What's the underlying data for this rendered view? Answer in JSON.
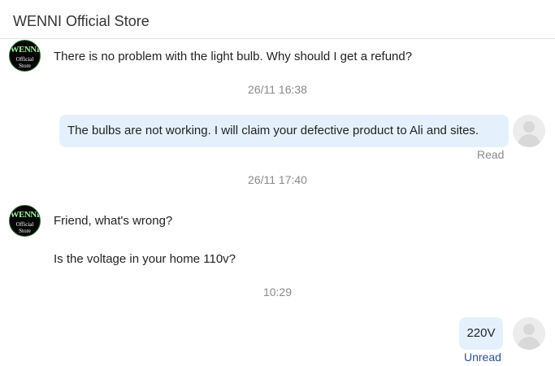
{
  "header": {
    "title": "WENNI Official Store"
  },
  "store_avatar": {
    "line1": "WENNI",
    "line2": "Official",
    "line3": "Store"
  },
  "messages": [
    {
      "from": "store",
      "text": "There is no problem with the light bulb. Why should I get a refund?"
    },
    {
      "timestamp": "26/11 16:38"
    },
    {
      "from": "user",
      "text": "The bulbs are not working. I will claim your defective product to Ali and sites.",
      "status": "Read"
    },
    {
      "timestamp": "26/11 17:40"
    },
    {
      "from": "store",
      "text": "Friend, what's wrong?"
    },
    {
      "from": "store",
      "text": "Is the voltage in your home 110v?"
    },
    {
      "timestamp": "10:29"
    },
    {
      "from": "user",
      "text": "220V",
      "status": "Unread"
    }
  ],
  "colors": {
    "user_bubble": "#e4f1fd",
    "timestamp_text": "#8a8a8a",
    "unread_status": "#2e4f8a",
    "store_avatar_bg": "#050505",
    "store_avatar_accent": "#9af09a"
  }
}
